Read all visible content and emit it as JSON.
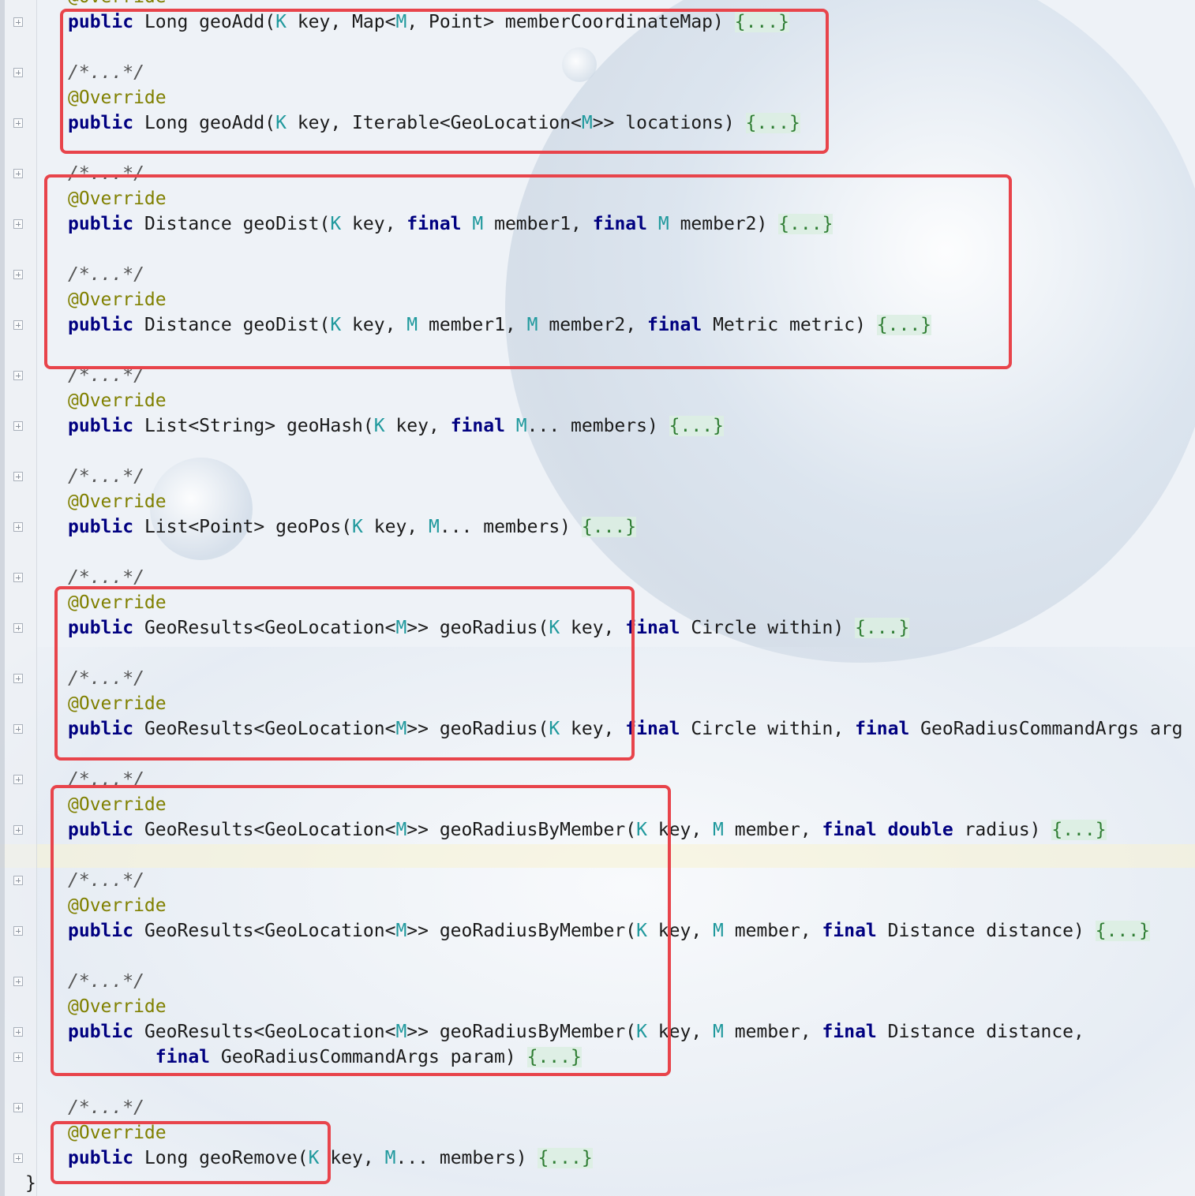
{
  "editor": {
    "top_partial": "@Override",
    "blocks": [
      {
        "comment": "",
        "annotation": "",
        "lines": [
          [
            "kw",
            "public"
          ],
          [
            "",
            "Long geoAdd("
          ],
          [
            "tp",
            "K"
          ],
          [
            "",
            "key, Map<"
          ],
          [
            "tp",
            "M"
          ],
          [
            "",
            ", Point> memberCoordinateMap) "
          ],
          [
            "fd",
            "{...}"
          ]
        ]
      },
      {
        "comment": "/*...*/",
        "annotation": "@Override",
        "lines": [
          [
            "kw",
            "public"
          ],
          [
            "",
            "Long geoAdd("
          ],
          [
            "tp",
            "K"
          ],
          [
            "",
            "key, Iterable<GeoLocation<"
          ],
          [
            "tp",
            "M"
          ],
          [
            ">> locations) ",
            ""
          ],
          [
            "fd",
            "{...}"
          ]
        ]
      },
      {
        "comment": "/*...*/",
        "annotation": "@Override",
        "lines": [
          [
            "kw",
            "public"
          ],
          [
            "",
            "Distance geoDist("
          ],
          [
            "tp",
            "K"
          ],
          [
            "",
            "key, "
          ],
          [
            "kw",
            "final"
          ],
          [
            "tp",
            "M"
          ],
          [
            "",
            "member1, "
          ],
          [
            "kw",
            "final"
          ],
          [
            "tp",
            "M"
          ],
          [
            "",
            "member2) "
          ],
          [
            "fd",
            "{...}"
          ]
        ]
      }
    ],
    "code_lines": [
      {
        "t": "ann",
        "text": "@Override"
      },
      {
        "t": "sig",
        "parts": [
          [
            "kw",
            "public"
          ],
          [
            "",
            " Long geoAdd("
          ],
          [
            "tp",
            "K"
          ],
          [
            "",
            " key, Map<"
          ],
          [
            "tp",
            "M"
          ],
          [
            "",
            ", Point> memberCoordinateMap) "
          ],
          [
            "fd",
            "{...}"
          ]
        ]
      },
      {
        "t": "blank"
      },
      {
        "t": "cmt",
        "text": "/*...*/"
      },
      {
        "t": "ann",
        "text": "@Override"
      },
      {
        "t": "sig",
        "parts": [
          [
            "kw",
            "public"
          ],
          [
            "",
            " Long geoAdd("
          ],
          [
            "tp",
            "K"
          ],
          [
            "",
            " key, Iterable<GeoLocation<"
          ],
          [
            "tp",
            "M"
          ],
          [
            "",
            ">> locations) "
          ],
          [
            "fd",
            "{...}"
          ]
        ]
      },
      {
        "t": "blank"
      },
      {
        "t": "cmt",
        "text": "/*...*/"
      },
      {
        "t": "ann",
        "text": "@Override"
      },
      {
        "t": "sig",
        "parts": [
          [
            "kw",
            "public"
          ],
          [
            "",
            " Distance geoDist("
          ],
          [
            "tp",
            "K"
          ],
          [
            "",
            " key, "
          ],
          [
            "kw",
            "final"
          ],
          [
            "",
            " "
          ],
          [
            "tp",
            "M"
          ],
          [
            "",
            " member1, "
          ],
          [
            "kw",
            "final"
          ],
          [
            "",
            " "
          ],
          [
            "tp",
            "M"
          ],
          [
            "",
            " member2) "
          ],
          [
            "fd",
            "{...}"
          ]
        ]
      },
      {
        "t": "blank"
      },
      {
        "t": "cmt",
        "text": "/*...*/"
      },
      {
        "t": "ann",
        "text": "@Override"
      },
      {
        "t": "sig",
        "parts": [
          [
            "kw",
            "public"
          ],
          [
            "",
            " Distance geoDist("
          ],
          [
            "tp",
            "K"
          ],
          [
            "",
            " key, "
          ],
          [
            "tp",
            "M"
          ],
          [
            "",
            " member1, "
          ],
          [
            "tp",
            "M"
          ],
          [
            "",
            " member2, "
          ],
          [
            "kw",
            "final"
          ],
          [
            "",
            " Metric metric) "
          ],
          [
            "fd",
            "{...}"
          ]
        ]
      },
      {
        "t": "blank"
      },
      {
        "t": "cmt",
        "text": "/*...*/"
      },
      {
        "t": "ann",
        "text": "@Override"
      },
      {
        "t": "sig",
        "parts": [
          [
            "kw",
            "public"
          ],
          [
            "",
            " List<String> geoHash("
          ],
          [
            "tp",
            "K"
          ],
          [
            "",
            " key, "
          ],
          [
            "kw",
            "final"
          ],
          [
            "",
            " "
          ],
          [
            "tp",
            "M"
          ],
          [
            "",
            "... members) "
          ],
          [
            "fd",
            "{...}"
          ]
        ]
      },
      {
        "t": "blank"
      },
      {
        "t": "cmt",
        "text": "/*...*/"
      },
      {
        "t": "ann",
        "text": "@Override"
      },
      {
        "t": "sig",
        "parts": [
          [
            "kw",
            "public"
          ],
          [
            "",
            " List<Point> geoPos("
          ],
          [
            "tp",
            "K"
          ],
          [
            "",
            " key, "
          ],
          [
            "tp",
            "M"
          ],
          [
            "",
            "... members) "
          ],
          [
            "fd",
            "{...}"
          ]
        ]
      },
      {
        "t": "blank"
      },
      {
        "t": "cmt",
        "text": "/*...*/"
      },
      {
        "t": "ann",
        "text": "@Override"
      },
      {
        "t": "sig",
        "parts": [
          [
            "kw",
            "public"
          ],
          [
            "",
            " GeoResults<GeoLocation<"
          ],
          [
            "tp",
            "M"
          ],
          [
            "",
            ">> geoRadius("
          ],
          [
            "tp",
            "K"
          ],
          [
            "",
            " key, "
          ],
          [
            "kw",
            "final"
          ],
          [
            "",
            " Circle within) "
          ],
          [
            "fd",
            "{...}"
          ]
        ]
      },
      {
        "t": "blank"
      },
      {
        "t": "cmt",
        "text": "/*...*/"
      },
      {
        "t": "ann",
        "text": "@Override"
      },
      {
        "t": "sig",
        "parts": [
          [
            "kw",
            "public"
          ],
          [
            "",
            " GeoResults<GeoLocation<"
          ],
          [
            "tp",
            "M"
          ],
          [
            "",
            ">> geoRadius("
          ],
          [
            "tp",
            "K"
          ],
          [
            "",
            " key, "
          ],
          [
            "kw",
            "final"
          ],
          [
            "",
            " Circle within, "
          ],
          [
            "kw",
            "final"
          ],
          [
            "",
            " GeoRadiusCommandArgs arg"
          ]
        ]
      },
      {
        "t": "blank"
      },
      {
        "t": "cmt",
        "text": "/*...*/"
      },
      {
        "t": "ann",
        "text": "@Override"
      },
      {
        "t": "sig",
        "parts": [
          [
            "kw",
            "public"
          ],
          [
            "",
            " GeoResults<GeoLocation<"
          ],
          [
            "tp",
            "M"
          ],
          [
            "",
            ">> geoRadiusByMember("
          ],
          [
            "tp",
            "K"
          ],
          [
            "",
            " key, "
          ],
          [
            "tp",
            "M"
          ],
          [
            "",
            " member, "
          ],
          [
            "kw",
            "final"
          ],
          [
            "",
            " "
          ],
          [
            "kw",
            "double"
          ],
          [
            "",
            " radius) "
          ],
          [
            "fd",
            "{...}"
          ]
        ]
      },
      {
        "t": "blank"
      },
      {
        "t": "cmt",
        "text": "/*...*/"
      },
      {
        "t": "ann",
        "text": "@Override"
      },
      {
        "t": "sig",
        "parts": [
          [
            "kw",
            "public"
          ],
          [
            "",
            " GeoResults<GeoLocation<"
          ],
          [
            "tp",
            "M"
          ],
          [
            "",
            ">> geoRadiusByMember("
          ],
          [
            "tp",
            "K"
          ],
          [
            "",
            " key, "
          ],
          [
            "tp",
            "M"
          ],
          [
            "",
            " member, "
          ],
          [
            "kw",
            "final"
          ],
          [
            "",
            " Distance distance) "
          ],
          [
            "fd",
            "{...}"
          ]
        ]
      },
      {
        "t": "blank"
      },
      {
        "t": "cmt",
        "text": "/*...*/"
      },
      {
        "t": "ann",
        "text": "@Override"
      },
      {
        "t": "sig",
        "parts": [
          [
            "kw",
            "public"
          ],
          [
            "",
            " GeoResults<GeoLocation<"
          ],
          [
            "tp",
            "M"
          ],
          [
            "",
            ">> geoRadiusByMember("
          ],
          [
            "tp",
            "K"
          ],
          [
            "",
            " key, "
          ],
          [
            "tp",
            "M"
          ],
          [
            "",
            " member, "
          ],
          [
            "kw",
            "final"
          ],
          [
            "",
            " Distance distance,"
          ]
        ]
      },
      {
        "t": "sig",
        "parts": [
          [
            "",
            "        "
          ],
          [
            "kw",
            "final"
          ],
          [
            "",
            " GeoRadiusCommandArgs param) "
          ],
          [
            "fd",
            "{...}"
          ]
        ]
      },
      {
        "t": "blank"
      },
      {
        "t": "cmt",
        "text": "/*...*/"
      },
      {
        "t": "ann",
        "text": "@Override"
      },
      {
        "t": "sig",
        "parts": [
          [
            "kw",
            "public"
          ],
          [
            "",
            " Long geoRemove("
          ],
          [
            "tp",
            "K"
          ],
          [
            "",
            " key, "
          ],
          [
            "tp",
            "M"
          ],
          [
            "",
            "... members) "
          ],
          [
            "fd",
            "{...}"
          ]
        ]
      }
    ],
    "closing_brace": "}"
  },
  "colors": {
    "keyword": "#000080",
    "type_param": "#20999d",
    "annotation": "#808000",
    "fold": "#2e7d32",
    "highlight_box": "#e8444b"
  }
}
